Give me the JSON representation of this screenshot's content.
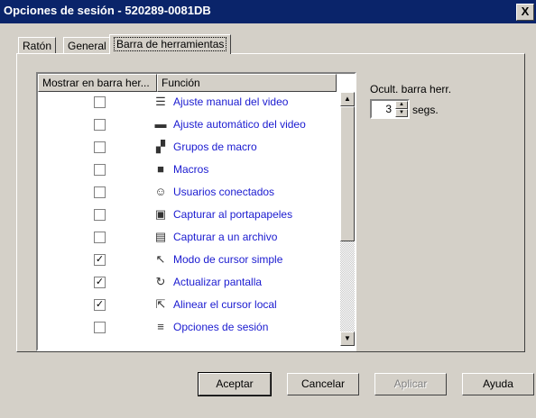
{
  "window": {
    "title": "Opciones de sesión - 520289-0081DB",
    "close_label": "X"
  },
  "tabs": [
    {
      "label": "Ratón",
      "active": false
    },
    {
      "label": "General",
      "active": false
    },
    {
      "label": "Barra de herramientas",
      "active": true
    }
  ],
  "list": {
    "columns": [
      "Mostrar en barra her...",
      "Función"
    ],
    "rows": [
      {
        "checked": false,
        "icon": "manual-video-icon",
        "label": "Ajuste manual del video"
      },
      {
        "checked": false,
        "icon": "auto-video-icon",
        "label": "Ajuste automático del video"
      },
      {
        "checked": false,
        "icon": "macro-group-icon",
        "label": "Grupos de macro"
      },
      {
        "checked": false,
        "icon": "macro-icon",
        "label": "Macros"
      },
      {
        "checked": false,
        "icon": "users-icon",
        "label": "Usuarios conectados"
      },
      {
        "checked": false,
        "icon": "clipboard-capture-icon",
        "label": "Capturar al portapapeles"
      },
      {
        "checked": false,
        "icon": "file-capture-icon",
        "label": "Capturar a un archivo"
      },
      {
        "checked": true,
        "icon": "single-cursor-icon",
        "label": "Modo de cursor simple"
      },
      {
        "checked": true,
        "icon": "refresh-icon",
        "label": "Actualizar pantalla"
      },
      {
        "checked": true,
        "icon": "align-cursor-icon",
        "label": "Alinear el cursor local"
      },
      {
        "checked": false,
        "icon": "session-options-icon",
        "label": "Opciones de sesión"
      }
    ]
  },
  "hide_toolbar": {
    "label": "Ocult. barra herr.",
    "value": "3",
    "unit": "segs."
  },
  "buttons": {
    "ok": "Aceptar",
    "cancel": "Cancelar",
    "apply": "Aplicar",
    "help": "Ayuda"
  }
}
